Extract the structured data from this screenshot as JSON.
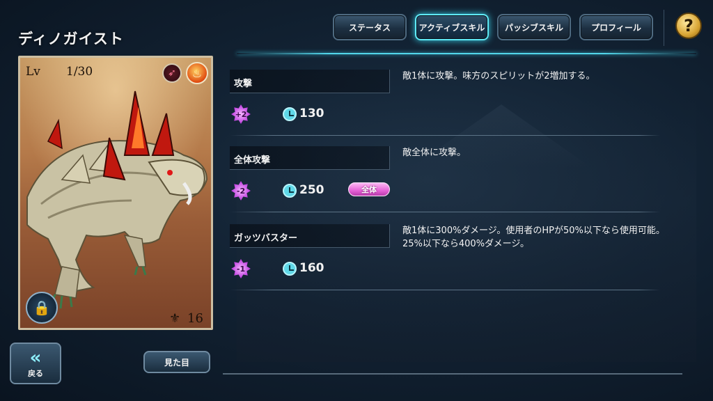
{
  "header": {
    "title": "ディノガイスト"
  },
  "tabs": [
    {
      "label": "ステータス",
      "active": false
    },
    {
      "label": "アクティブスキル",
      "active": true
    },
    {
      "label": "パッシブスキル",
      "active": false
    },
    {
      "label": "プロフィール",
      "active": false
    }
  ],
  "help": {
    "label": "?"
  },
  "card": {
    "lv_label": "Lv",
    "lv_value": "1/30",
    "count_value": "16",
    "element_icons": [
      "dash-skill-icon",
      "fire-element-icon"
    ]
  },
  "skills": [
    {
      "name": "攻撃",
      "spirit": "+2",
      "cost": "130",
      "description": "敵1体に攻撃。味方のスピリットが2増加する。",
      "badge": ""
    },
    {
      "name": "全体攻撃",
      "spirit": "-2",
      "cost": "250",
      "description": "敵全体に攻撃。",
      "badge": "全体"
    },
    {
      "name": "ガッツバスター",
      "spirit": "-1",
      "cost": "160",
      "description": "敵1体に300%ダメージ。使用者のHPが50%以下なら使用可能。25%以下なら400%ダメージ。",
      "badge": ""
    }
  ],
  "buttons": {
    "back_label": "戻る",
    "look_label": "見た目"
  },
  "colors": {
    "accent": "#52d6ea",
    "spirit": "#c040e0",
    "badge": "#e462d6"
  }
}
